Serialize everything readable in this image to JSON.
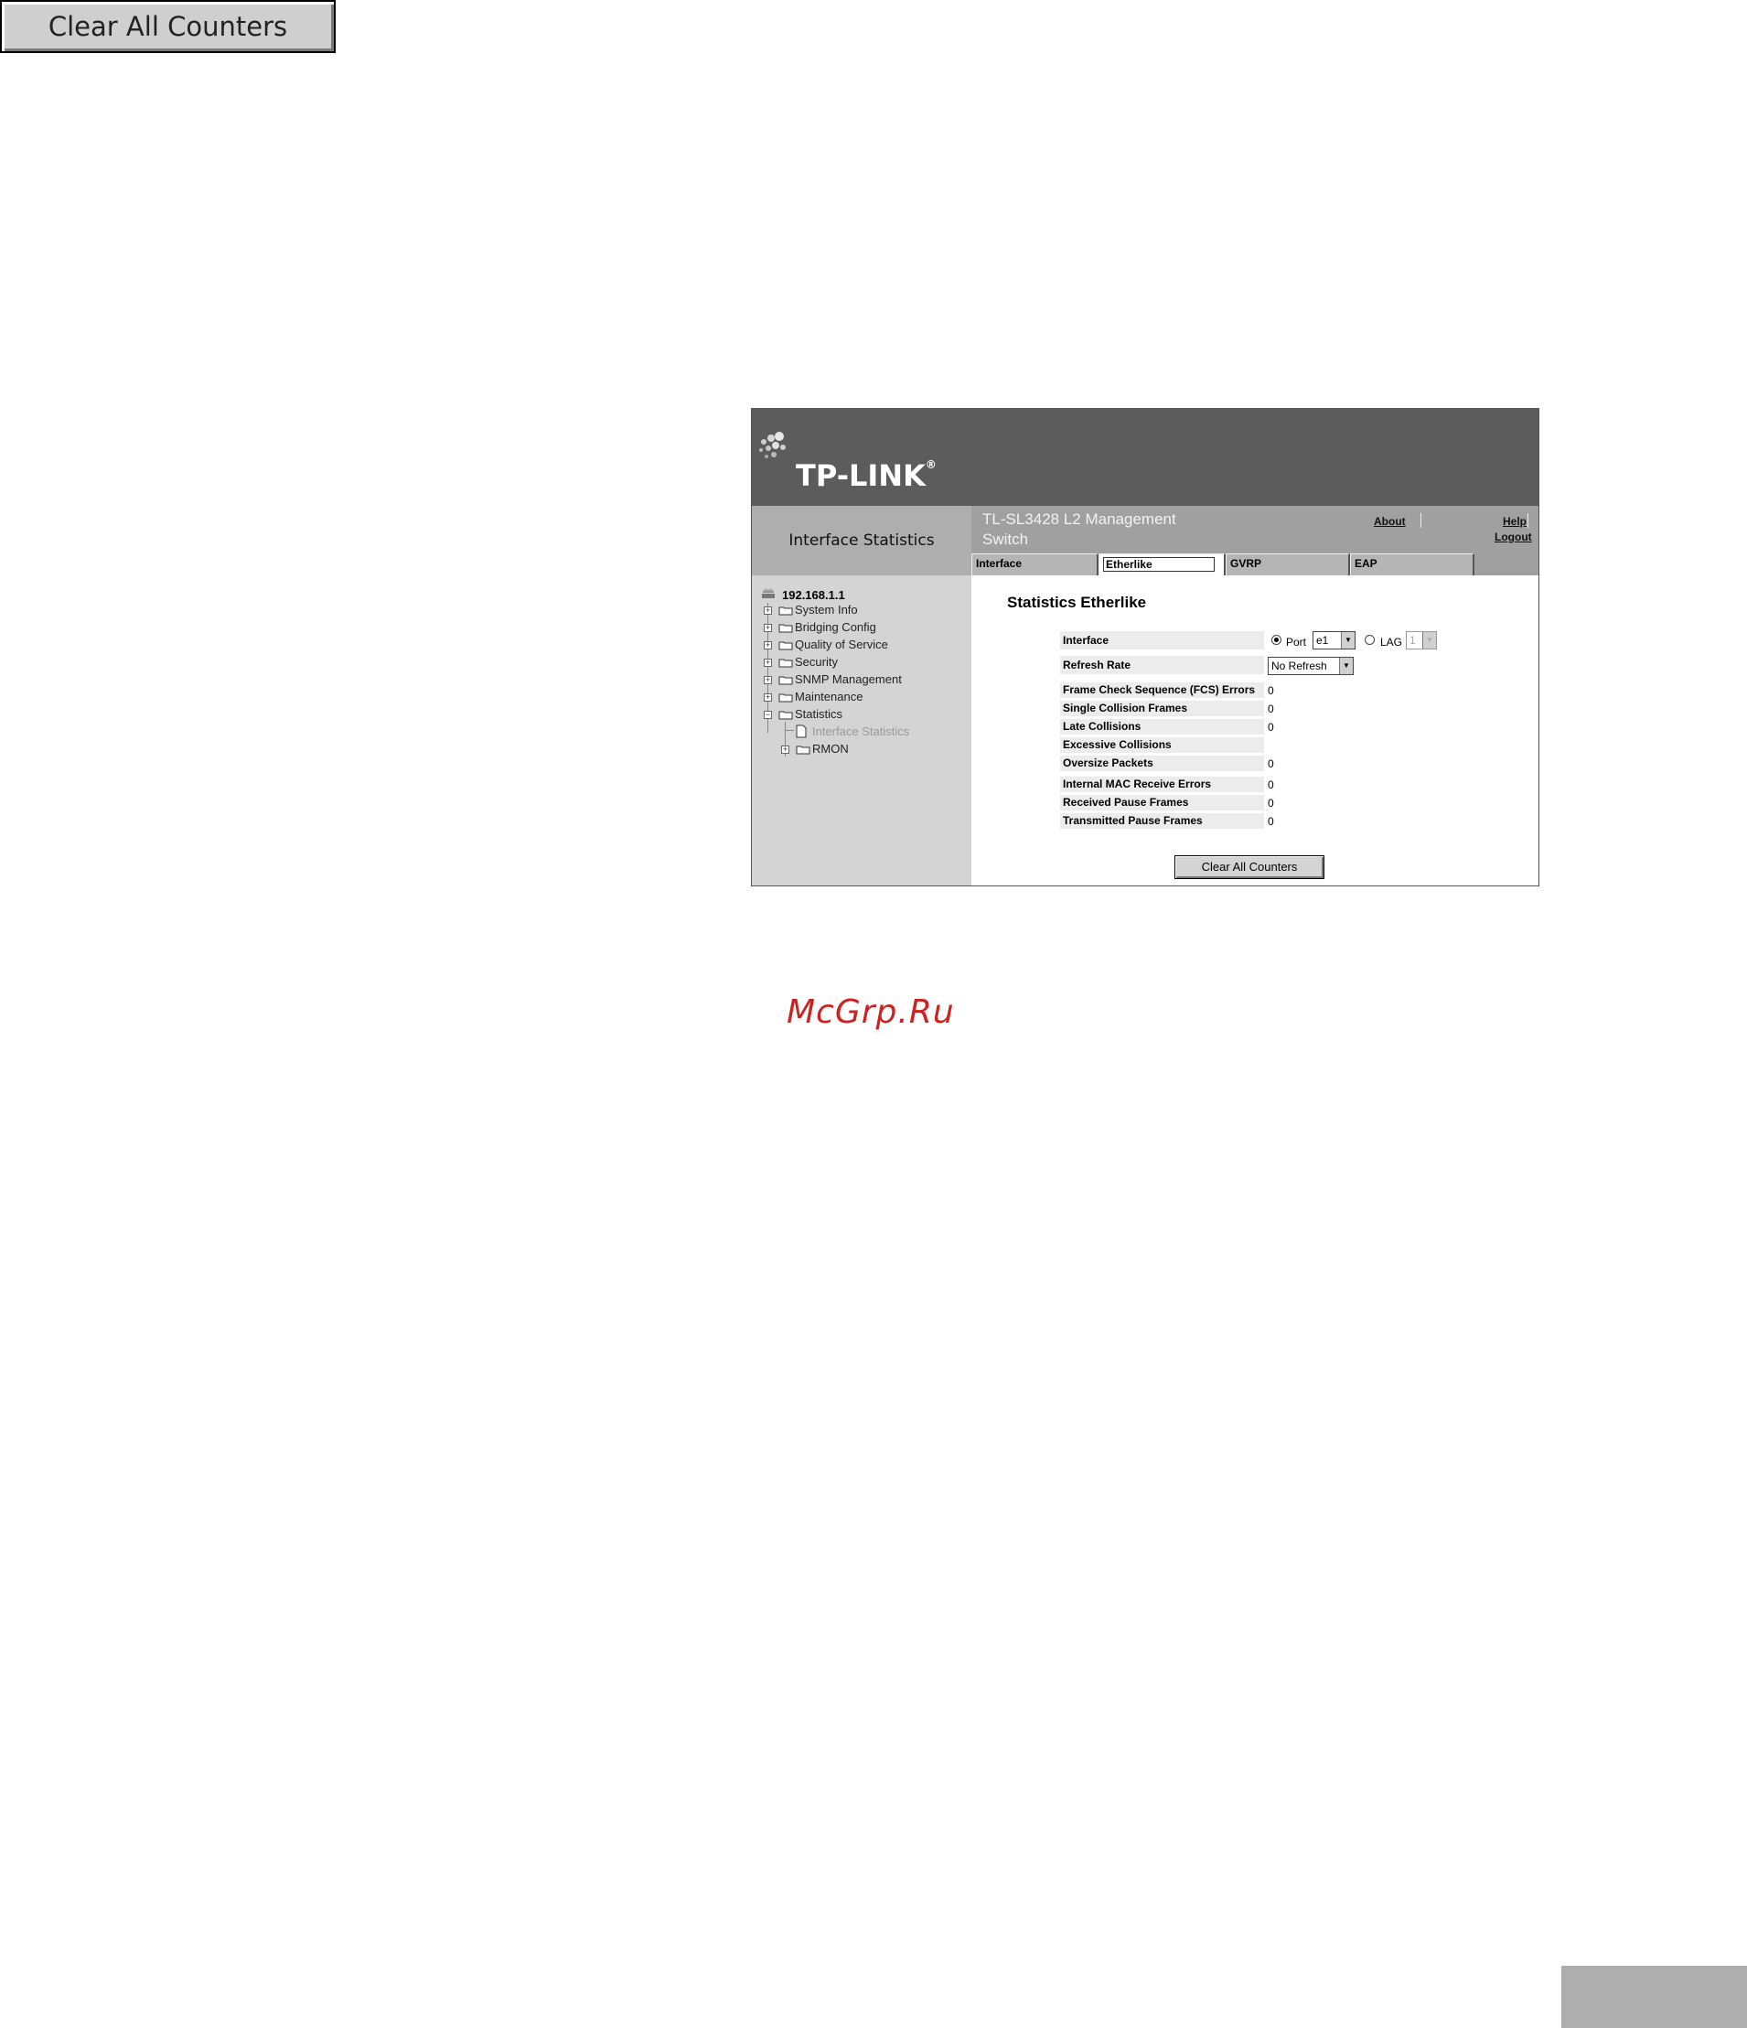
{
  "top_button": {
    "label": "Clear All Counters"
  },
  "header": {
    "logo": "TP-LINK",
    "logo_mark": "®",
    "page_heading": "Interface Statistics",
    "product_title": "TL-SL3428 L2 Management Switch",
    "links": {
      "about": "About",
      "help": "Help",
      "logout": "Logout"
    }
  },
  "tabs": [
    {
      "label": "Interface"
    },
    {
      "label": "Etherlike"
    },
    {
      "label": "GVRP"
    },
    {
      "label": "EAP"
    }
  ],
  "tree": {
    "root": "192.168.1.1",
    "items": [
      "System Info",
      "Bridging Config",
      "Quality of Service",
      "Security",
      "SNMP Management",
      "Maintenance",
      "Statistics",
      "Interface Statistics",
      "RMON"
    ]
  },
  "form": {
    "title": "Statistics Etherlike",
    "interface_label": "Interface",
    "port_label": "Port",
    "port_value": "e1",
    "lag_label": "LAG",
    "lag_value": "1",
    "refresh_label": "Refresh Rate",
    "refresh_value": "No Refresh",
    "rows": [
      {
        "label": "Frame Check Sequence (FCS) Errors",
        "value": "0"
      },
      {
        "label": "Single Collision Frames",
        "value": "0"
      },
      {
        "label": "Late Collisions",
        "value": "0"
      },
      {
        "label": "Excessive Collisions",
        "value": ""
      },
      {
        "label": "Oversize Packets",
        "value": "0"
      },
      {
        "label": "Internal MAC Receive Errors",
        "value": "0"
      },
      {
        "label": "Received Pause Frames",
        "value": "0"
      },
      {
        "label": "Transmitted Pause Frames",
        "value": "0"
      }
    ],
    "button_label": "Clear All Counters"
  },
  "watermark": "McGrp.Ru"
}
